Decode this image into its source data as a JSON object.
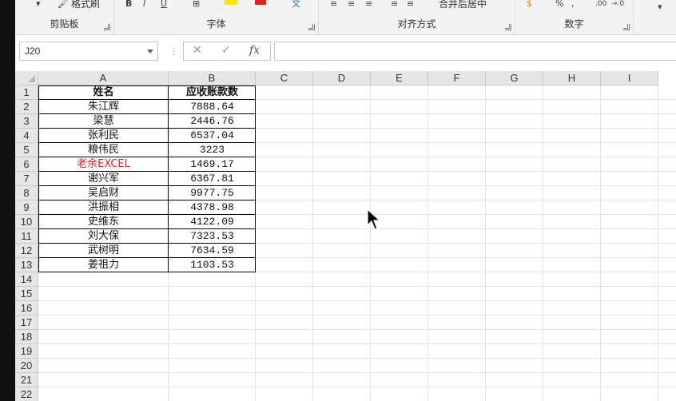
{
  "ribbon": {
    "format_painter_label": "格式刷",
    "groups": [
      {
        "name": "剪贴板"
      },
      {
        "name": "字体"
      },
      {
        "name": "对齐方式"
      },
      {
        "name": "数字"
      }
    ],
    "merge_label": "合并后居中",
    "percent_symbol": "%",
    "decimal_inc": ".00",
    "decimal_dec": "→.0"
  },
  "formula_bar": {
    "name_box_value": "J20",
    "cancel_symbol": "✕",
    "enter_symbol": "✓",
    "fx_symbol": "fx",
    "formula_value": ""
  },
  "columns": [
    "A",
    "B",
    "C",
    "D",
    "E",
    "F",
    "G",
    "H",
    "I"
  ],
  "rows": [
    "1",
    "2",
    "3",
    "4",
    "5",
    "6",
    "7",
    "8",
    "9",
    "10",
    "11",
    "12",
    "13",
    "14",
    "15",
    "16",
    "17",
    "18",
    "19",
    "20",
    "21",
    "22"
  ],
  "table": {
    "header": {
      "name": "姓名",
      "amount": "应收账款数"
    },
    "records": [
      {
        "name": "朱江辉",
        "amount": "7888.64"
      },
      {
        "name": "梁慧",
        "amount": "2446.76"
      },
      {
        "name": "张利民",
        "amount": "6537.04"
      },
      {
        "name": "粮伟民",
        "amount": "3223"
      },
      {
        "name": "老余EXCEL",
        "amount": "1469.17",
        "name_color": "#e0201c"
      },
      {
        "name": "谢兴军",
        "amount": "6367.81"
      },
      {
        "name": "吴启财",
        "amount": "9977.75"
      },
      {
        "name": "洪振相",
        "amount": "4378.98"
      },
      {
        "name": "史维东",
        "amount": "4122.09"
      },
      {
        "name": "刘大保",
        "amount": "7323.53"
      },
      {
        "name": "武树明",
        "amount": "7634.59"
      },
      {
        "name": "姜祖力",
        "amount": "1103.53"
      }
    ]
  },
  "colors": {
    "highlight_red": "#e0201c",
    "ribbon_bg": "#f3f3f3",
    "header_bg": "#e6e6e6"
  }
}
